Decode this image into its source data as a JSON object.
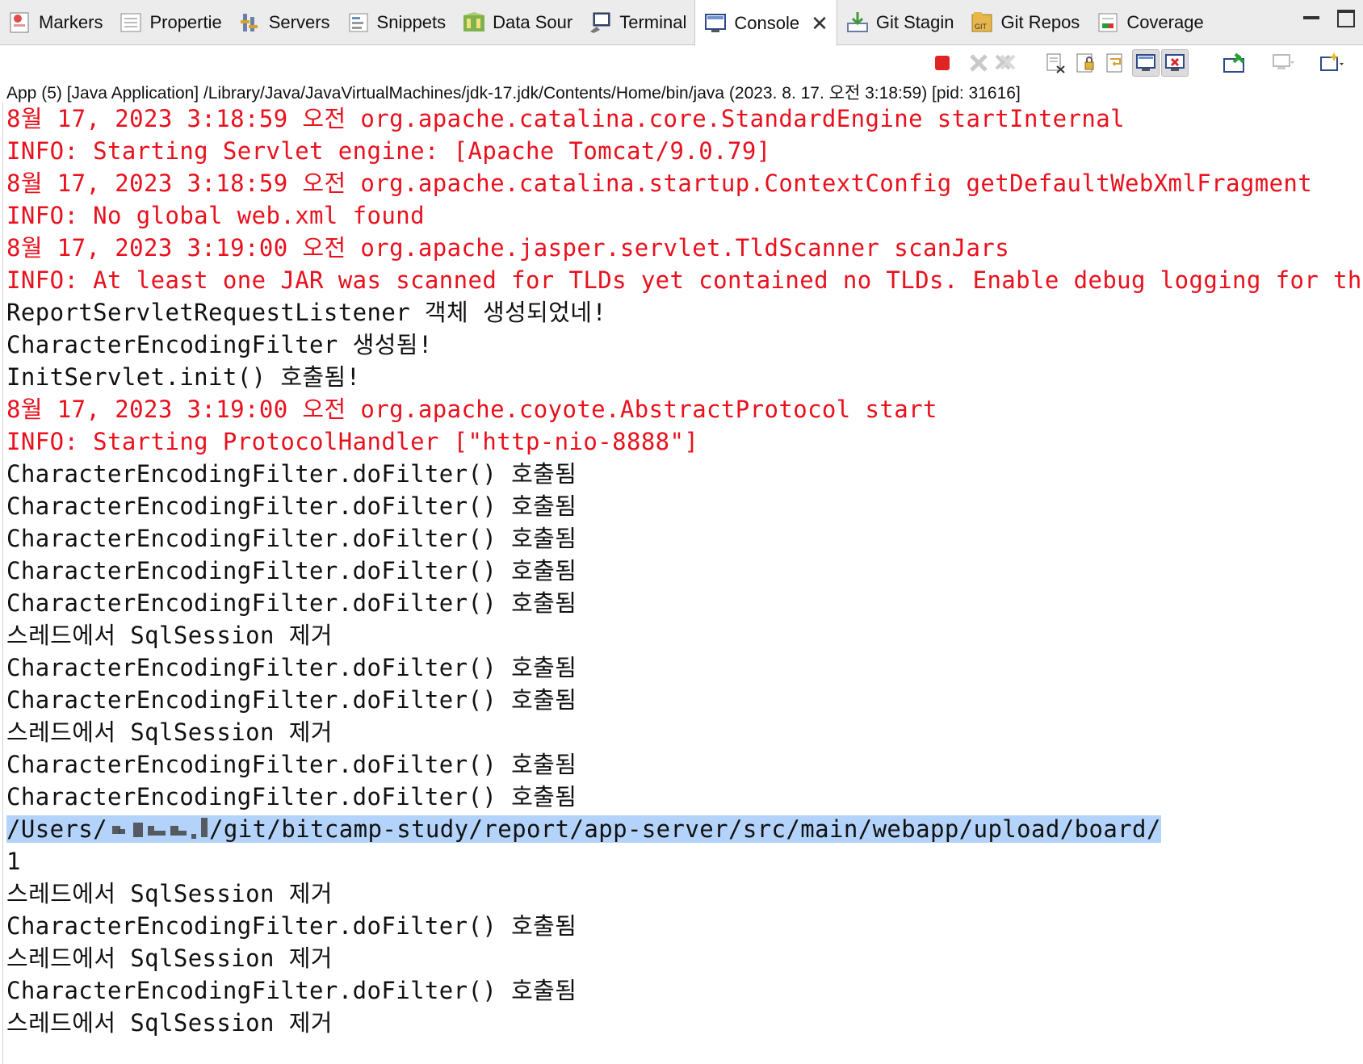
{
  "tabs": [
    {
      "label": "Markers",
      "icon": "markers-icon"
    },
    {
      "label": "Propertie",
      "icon": "properties-icon"
    },
    {
      "label": "Servers",
      "icon": "servers-icon"
    },
    {
      "label": "Snippets",
      "icon": "snippets-icon"
    },
    {
      "label": "Data Sour",
      "icon": "data-source-icon"
    },
    {
      "label": "Terminal",
      "icon": "terminal-icon"
    },
    {
      "label": "Console",
      "icon": "console-icon",
      "active": true
    },
    {
      "label": "Git Stagin",
      "icon": "git-staging-icon"
    },
    {
      "label": "Git Repos",
      "icon": "git-repos-icon"
    },
    {
      "label": "Coverage",
      "icon": "coverage-icon"
    }
  ],
  "toolbar_icons": [
    "terminate-icon",
    "remove-launch-icon",
    "remove-all-terminated-icon",
    "clear-console-icon",
    "scroll-lock-icon",
    "word-wrap-icon",
    "show-on-stdout-icon",
    "show-on-stderr-icon",
    "pin-console-icon",
    "display-selected-console-icon",
    "open-console-icon"
  ],
  "process_label": "App (5) [Java Application] /Library/Java/JavaVirtualMachines/jdk-17.jdk/Contents/Home/bin/java  (2023. 8. 17. 오전 3:18:59) [pid: 31616]",
  "colors": {
    "stderr": "#e8111d",
    "stdout": "#111111",
    "selection": "#b4d3fb"
  },
  "console_lines": [
    {
      "text": "8월 17, 2023 3:18:59 오전 org.apache.catalina.core.StandardEngine startInternal",
      "stream": "stderr"
    },
    {
      "text": "INFO: Starting Servlet engine: [Apache Tomcat/9.0.79]",
      "stream": "stderr"
    },
    {
      "text": "8월 17, 2023 3:18:59 오전 org.apache.catalina.startup.ContextConfig getDefaultWebXmlFragment",
      "stream": "stderr"
    },
    {
      "text": "INFO: No global web.xml found",
      "stream": "stderr"
    },
    {
      "text": "8월 17, 2023 3:19:00 오전 org.apache.jasper.servlet.TldScanner scanJars",
      "stream": "stderr"
    },
    {
      "text": "INFO: At least one JAR was scanned for TLDs yet contained no TLDs. Enable debug logging for this logger f",
      "stream": "stderr"
    },
    {
      "text": "ReportServletRequestListener 객체 생성되었네!",
      "stream": "stdout"
    },
    {
      "text": "CharacterEncodingFilter 생성됨!",
      "stream": "stdout"
    },
    {
      "text": "InitServlet.init() 호출됨!",
      "stream": "stdout"
    },
    {
      "text": "8월 17, 2023 3:19:00 오전 org.apache.coyote.AbstractProtocol start",
      "stream": "stderr"
    },
    {
      "text": "INFO: Starting ProtocolHandler [\"http-nio-8888\"]",
      "stream": "stderr"
    },
    {
      "text": "CharacterEncodingFilter.doFilter() 호출됨",
      "stream": "stdout"
    },
    {
      "text": "CharacterEncodingFilter.doFilter() 호출됨",
      "stream": "stdout"
    },
    {
      "text": "CharacterEncodingFilter.doFilter() 호출됨",
      "stream": "stdout"
    },
    {
      "text": "CharacterEncodingFilter.doFilter() 호출됨",
      "stream": "stdout"
    },
    {
      "text": "CharacterEncodingFilter.doFilter() 호출됨",
      "stream": "stdout"
    },
    {
      "text": "스레드에서 SqlSession 제거",
      "stream": "stdout"
    },
    {
      "text": "CharacterEncodingFilter.doFilter() 호출됨",
      "stream": "stdout"
    },
    {
      "text": "CharacterEncodingFilter.doFilter() 호출됨",
      "stream": "stdout"
    },
    {
      "text": "스레드에서 SqlSession 제거",
      "stream": "stdout"
    },
    {
      "text": "CharacterEncodingFilter.doFilter() 호출됨",
      "stream": "stdout"
    },
    {
      "text": "CharacterEncodingFilter.doFilter() 호출됨",
      "stream": "stdout"
    },
    {
      "text_before": "/Users/",
      "text_after": "/git/bitcamp-study/report/app-server/src/main/webapp/upload/board/",
      "stream": "stdout",
      "selected": true,
      "redacted": true
    },
    {
      "text": "1",
      "stream": "stdout"
    },
    {
      "text": "스레드에서 SqlSession 제거",
      "stream": "stdout"
    },
    {
      "text": "CharacterEncodingFilter.doFilter() 호출됨",
      "stream": "stdout"
    },
    {
      "text": "스레드에서 SqlSession 제거",
      "stream": "stdout"
    },
    {
      "text": "CharacterEncodingFilter.doFilter() 호출됨",
      "stream": "stdout"
    },
    {
      "text": "스레드에서 SqlSession 제거",
      "stream": "stdout"
    }
  ]
}
